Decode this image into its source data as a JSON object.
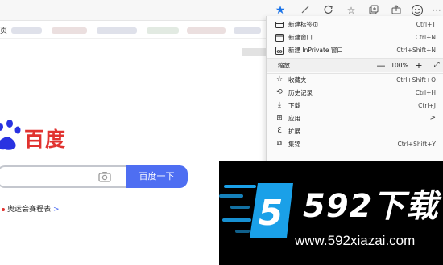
{
  "toolbar": {
    "icons": [
      "star-icon",
      "feather-icon",
      "refresh-icon",
      "favorites-icon",
      "collections-icon",
      "share-icon",
      "profile-icon",
      "more-icon"
    ]
  },
  "bookmarks": {
    "first_label": "页"
  },
  "baidu": {
    "logo_text": "百度",
    "search_button": "百度一下",
    "hot_link": "奥运会赛程表",
    "brand_color": "#e1322f",
    "button_color": "#4e6ef2"
  },
  "menu": {
    "items": [
      {
        "icon": "new-tab-icon",
        "label": "新建标签页",
        "shortcut": "Ctrl+T"
      },
      {
        "icon": "new-window-icon",
        "label": "新建窗口",
        "shortcut": "Ctrl+N"
      },
      {
        "icon": "inprivate-icon",
        "label": "新建 InPrivate 窗口",
        "shortcut": "Ctrl+Shift+N"
      }
    ],
    "zoom": {
      "label": "缩放",
      "minus": "—",
      "value": "100%",
      "plus": "+"
    },
    "items2": [
      {
        "icon": "favorites-icon",
        "label": "收藏夹",
        "shortcut": "Ctrl+Shift+O"
      },
      {
        "icon": "history-icon",
        "label": "历史记录",
        "shortcut": "Ctrl+H"
      },
      {
        "icon": "download-icon",
        "label": "下载",
        "shortcut": "Ctrl+J"
      },
      {
        "icon": "apps-icon",
        "label": "应用",
        "arrow": ">"
      },
      {
        "icon": "extensions-icon",
        "label": "扩展"
      },
      {
        "icon": "collections-icon",
        "label": "集锦",
        "shortcut": "Ctrl+Shift+Y"
      }
    ]
  },
  "watermark": {
    "brand": "592下载",
    "url": "www.592xiazai.com",
    "accent": "#1aa0e8"
  }
}
